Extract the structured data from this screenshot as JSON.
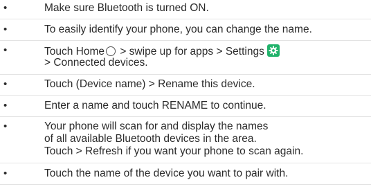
{
  "bullets": [
    {
      "lines": [
        "Make sure Bluetooth is turned ON."
      ]
    },
    {
      "lines": [
        "To easily identify your phone, you can change the name."
      ]
    },
    {
      "lines": [
        "Touch Home",
        " > swipe up for apps > Settings",
        "> Connected devices."
      ]
    },
    {
      "lines": [
        "Touch (Device name)  > Rename this device."
      ]
    },
    {
      "lines": [
        "Enter a name and touch RENAME to continue."
      ]
    },
    {
      "lines": [
        "Your phone will scan for and display the names",
        "of all available Bluetooth devices in the area.",
        "Touch  > Refresh if you want your phone to scan again."
      ]
    },
    {
      "lines": [
        "Touch the name of the device you want to pair with."
      ]
    }
  ],
  "bullet_glyph": "•",
  "icons": {
    "home": "home-circle-icon",
    "settings": "settings-gear-icon",
    "settings_color": "#21b36b"
  }
}
